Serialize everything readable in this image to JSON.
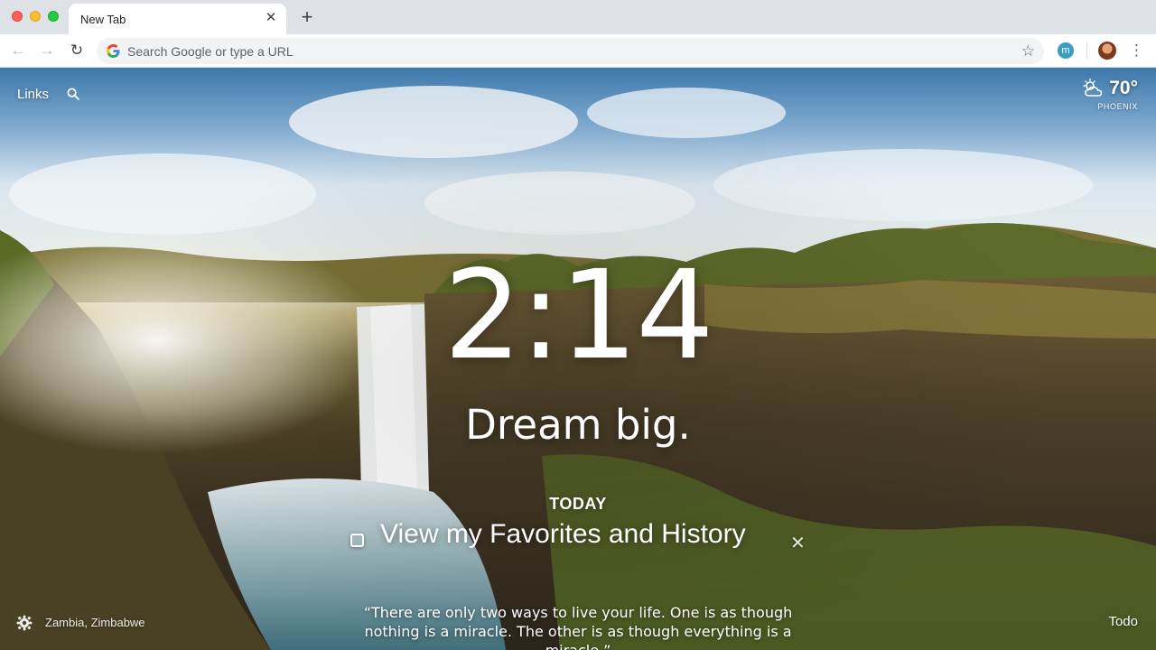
{
  "browser": {
    "tab_title": "New Tab",
    "tab_close": "✕",
    "new_tab": "+",
    "omnibox_placeholder": "Search Google or type a URL",
    "extension_badge": "m"
  },
  "dashboard": {
    "links_label": "Links",
    "weather": {
      "temperature": "70°",
      "location": "PHOENIX"
    },
    "clock": "2:14",
    "mantra": "Dream big.",
    "focus": {
      "heading": "TODAY",
      "task": "View my Favorites and History",
      "delete": "✕"
    },
    "photo_location": "Zambia, Zimbabwe",
    "quote": "“There are only two ways to live your life. One is as though nothing is a miracle. The other is as though everything is a miracle.”",
    "todo_label": "Todo"
  }
}
